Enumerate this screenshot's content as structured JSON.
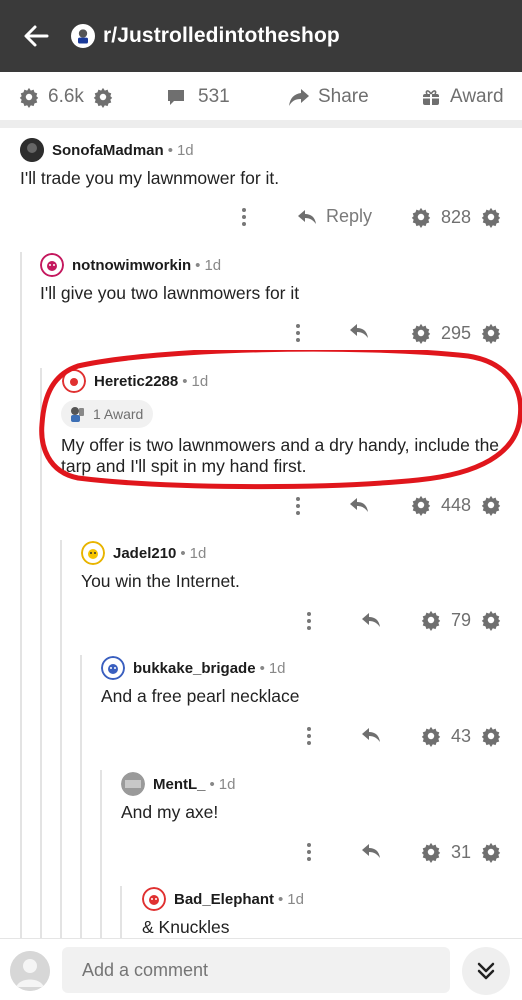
{
  "header": {
    "subreddit": "r/Justrolledintotheshop"
  },
  "post_actions": {
    "votes": "6.6k",
    "comments": "531",
    "share": "Share",
    "award": "Award"
  },
  "comments": [
    {
      "user": "SonofaMadman",
      "age": "1d",
      "text": "I'll trade you my lawnmower for it.",
      "reply": "Reply",
      "votes": "828"
    },
    {
      "user": "notnowimworkin",
      "age": "1d",
      "text": "I'll give you two lawnmowers for it",
      "votes": "295"
    },
    {
      "user": "Heretic2288",
      "age": "1d",
      "award": "1 Award",
      "text_line1": "My offer is two lawnmowers and a dry handy, include the",
      "text_line2": "tarp and I'll spit in my hand first.",
      "votes": "448"
    },
    {
      "user": "Jadel210",
      "age": "1d",
      "text": "You win the Internet.",
      "votes": "79"
    },
    {
      "user": "bukkake_brigade",
      "age": "1d",
      "text": "And a free pearl necklace",
      "votes": "43"
    },
    {
      "user": "MentL_",
      "age": "1d",
      "text": "And my axe!",
      "votes": "31"
    },
    {
      "user": "Bad_Elephant",
      "age": "1d",
      "text": "& Knuckles"
    }
  ],
  "composer": {
    "placeholder": "Add a comment"
  },
  "colors": {
    "topbar": "#3a3a3a",
    "highlight": "#e0161c",
    "muted": "#6f6f6f"
  }
}
